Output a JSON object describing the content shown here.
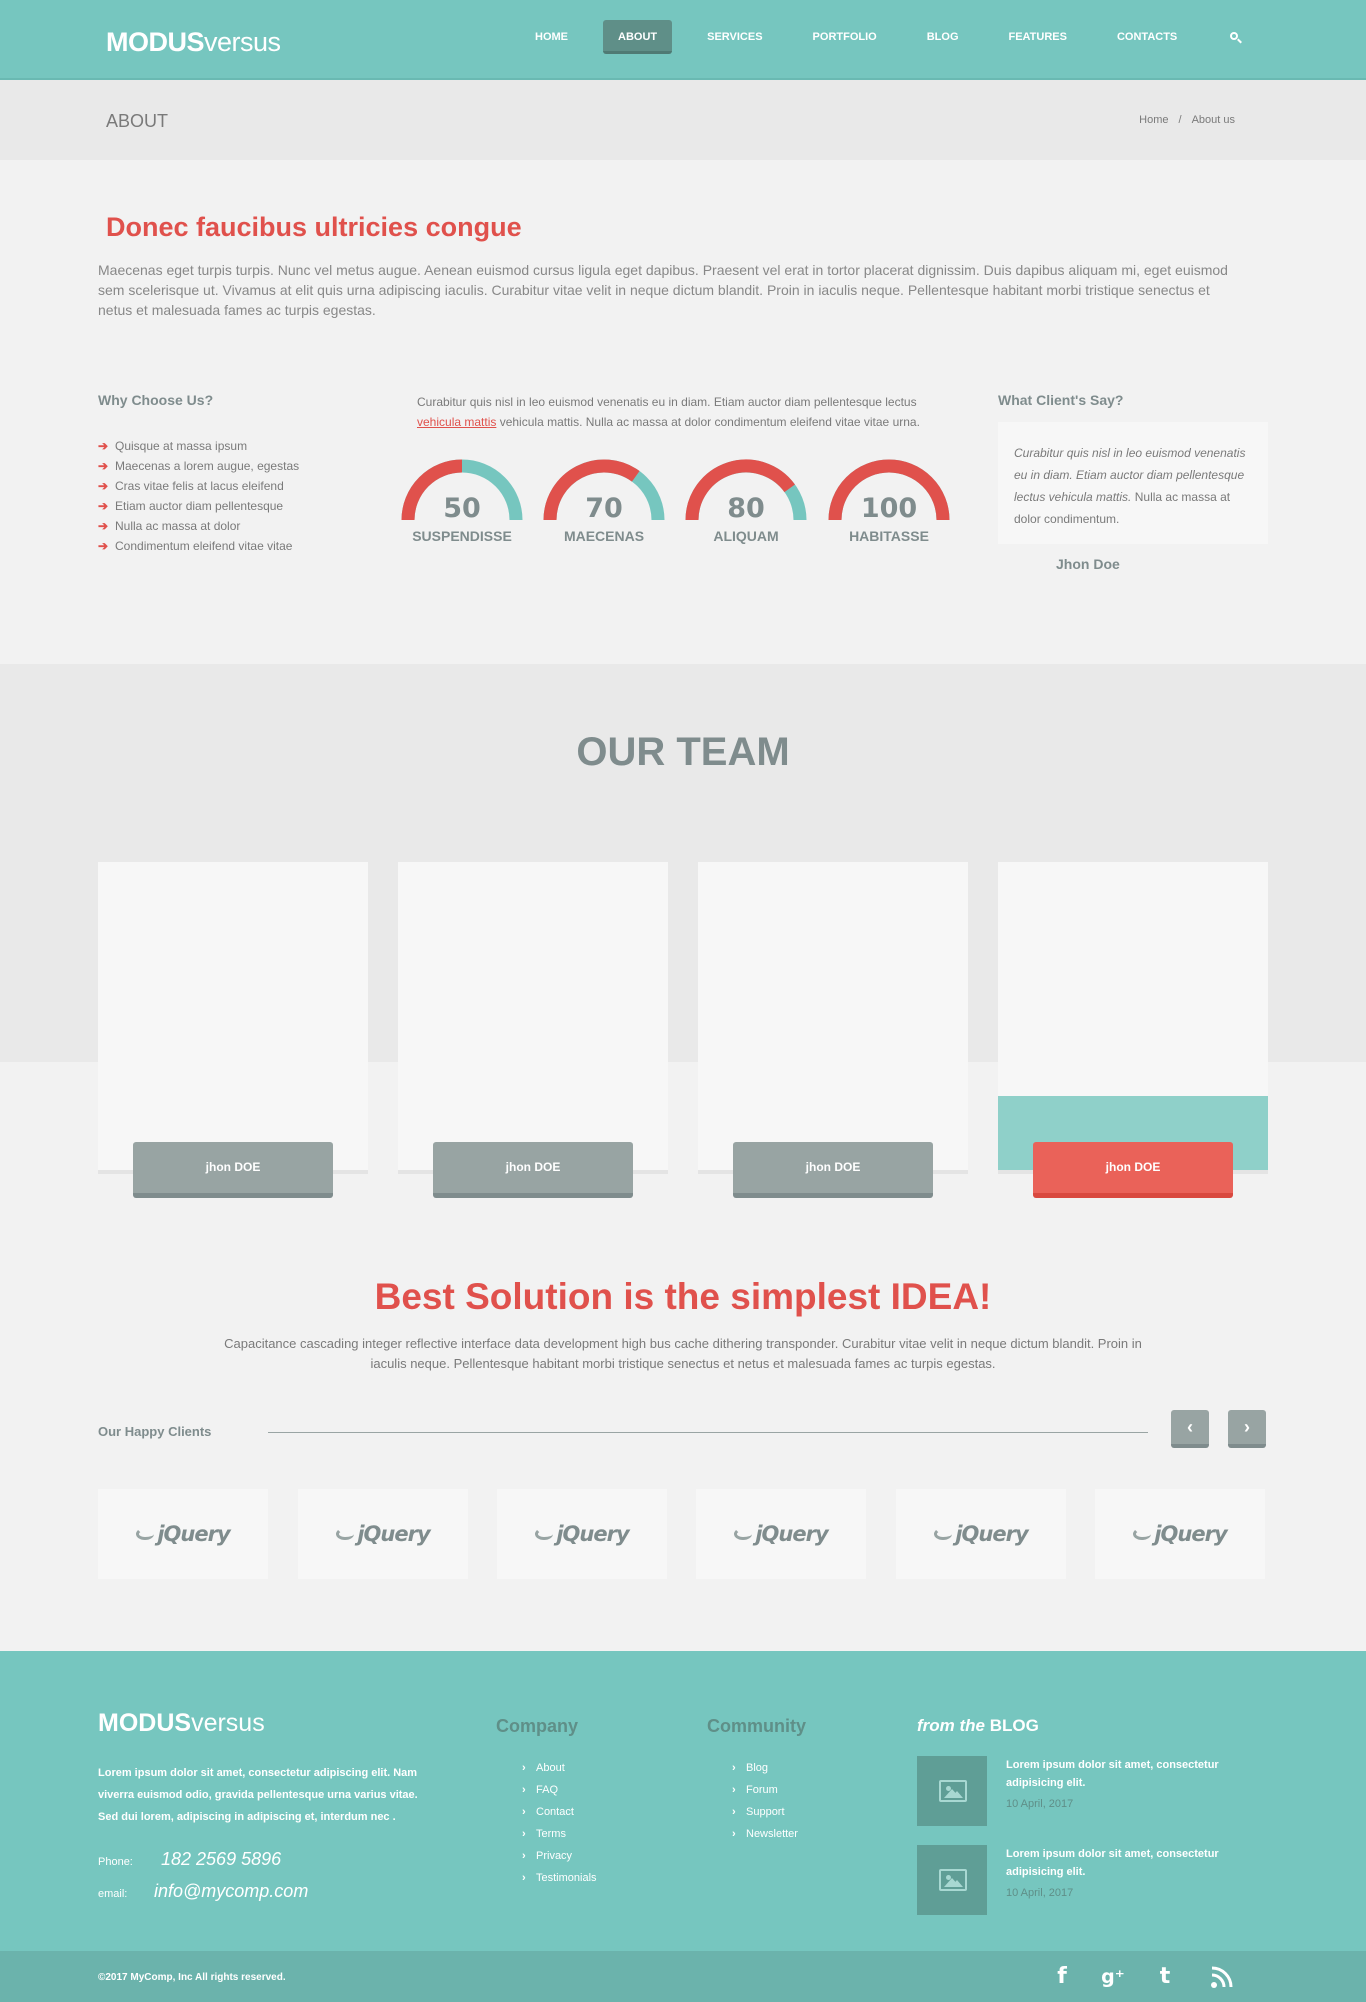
{
  "header": {
    "logo_bold": "MODUS",
    "logo_light": "versus",
    "nav": [
      "HOME",
      "ABOUT",
      "SERVICES",
      "PORTFOLIO",
      "BLOG",
      "FEATURES",
      "CONTACTS"
    ],
    "active_nav": "ABOUT",
    "search_icon": "search-icon"
  },
  "titlebar": {
    "title": "ABOUT",
    "breadcrumb": [
      "Home",
      "About us"
    ],
    "separator": "/"
  },
  "intro": {
    "title": "Donec faucibus ultricies congue",
    "text": "Maecenas eget turpis turpis. Nunc vel metus augue. Aenean euismod cursus ligula eget dapibus. Praesent vel erat in tortor placerat dignissim. Duis dapibus aliquam mi, eget euismod sem scelerisque ut. Vivamus at elit quis urna adipiscing iaculis. Curabitur vitae velit in neque dictum blandit. Proin in iaculis neque. Pellentesque habitant morbi tristique senectus et netus et malesuada fames ac turpis egestas."
  },
  "why": {
    "title": "Why Choose Us?",
    "items": [
      "Quisque at massa ipsum",
      "Maecenas a lorem augue, egestas",
      "Cras vitae felis at lacus eleifend",
      "Etiam auctor diam pellentesque",
      "Nulla ac massa at dolor",
      "Condimentum eleifend vitae vitae"
    ]
  },
  "center": {
    "text_before": "Curabitur quis nisl in leo euismod venenatis eu in diam. Etiam auctor diam pellentesque lectus ",
    "link": "vehicula mattis",
    "text_after": " vehicula mattis. Nulla ac massa at dolor condimentum eleifend vitae vitae urna."
  },
  "gauges": [
    {
      "value": 50,
      "label": "SUSPENDISSE"
    },
    {
      "value": 70,
      "label": "MAECENAS"
    },
    {
      "value": 80,
      "label": "ALIQUAM"
    },
    {
      "value": 100,
      "label": "HABITASSE"
    }
  ],
  "colors": {
    "accent_red": "#e0514c",
    "teal": "#76c6bf",
    "gray": "#7f8c8d"
  },
  "clients_say": {
    "title": "What Client's Say?",
    "quote_italic": "Curabitur quis nisl in leo euismod venenatis eu in diam. Etiam auctor diam pellentesque lectus vehicula mattis.",
    "quote_rest": " Nulla ac massa at dolor condimentum.",
    "author": "Jhon Doe"
  },
  "team": {
    "title": "OUR TEAM",
    "members": [
      "jhon DOE",
      "jhon DOE",
      "jhon DOE",
      "jhon DOE"
    ]
  },
  "best": {
    "title": "Best Solution is the simplest IDEA!",
    "text": "Capacitance cascading integer reflective interface data development high bus cache dithering transponder. Curabitur vitae velit in neque dictum blandit. Proin in iaculis neque. Pellentesque habitant morbi tristique senectus et netus et malesuada fames ac turpis egestas."
  },
  "clients": {
    "title": "Our Happy Clients",
    "prev": "‹",
    "next": "›",
    "logos": [
      "jQuery",
      "jQuery",
      "jQuery",
      "jQuery",
      "jQuery",
      "jQuery"
    ]
  },
  "footer": {
    "logo_bold": "MODUS",
    "logo_light": "versus",
    "about": "Lorem ipsum dolor sit amet, consectetur adipiscing elit. Nam viverra euismod odio, gravida pellentesque urna varius vitae. Sed dui lorem, adipiscing in adipiscing et, interdum nec .",
    "phone_label": "Phone:",
    "phone": "182 2569 5896",
    "email_label": "email:",
    "email": "info@mycomp.com",
    "company_title": "Company",
    "company_links": [
      "About",
      "FAQ",
      "Contact",
      "Terms",
      "Privacy",
      "Testimonials"
    ],
    "community_title": "Community",
    "community_links": [
      "Blog",
      "Forum",
      "Support",
      "Newsletter"
    ],
    "blog_title_italic": "from the",
    "blog_title_bold": "BLOG",
    "posts": [
      {
        "text": "Lorem ipsum dolor sit amet, consectetur adipisicing elit.",
        "date": "10 April, 2017"
      },
      {
        "text": "Lorem ipsum dolor sit amet, consectetur adipisicing elit.",
        "date": "10 April, 2017"
      }
    ],
    "copyright": "©2017 MyComp, Inc All rights reserved.",
    "social": [
      "facebook-icon",
      "google-plus-icon",
      "tumblr-icon",
      "rss-icon"
    ]
  }
}
